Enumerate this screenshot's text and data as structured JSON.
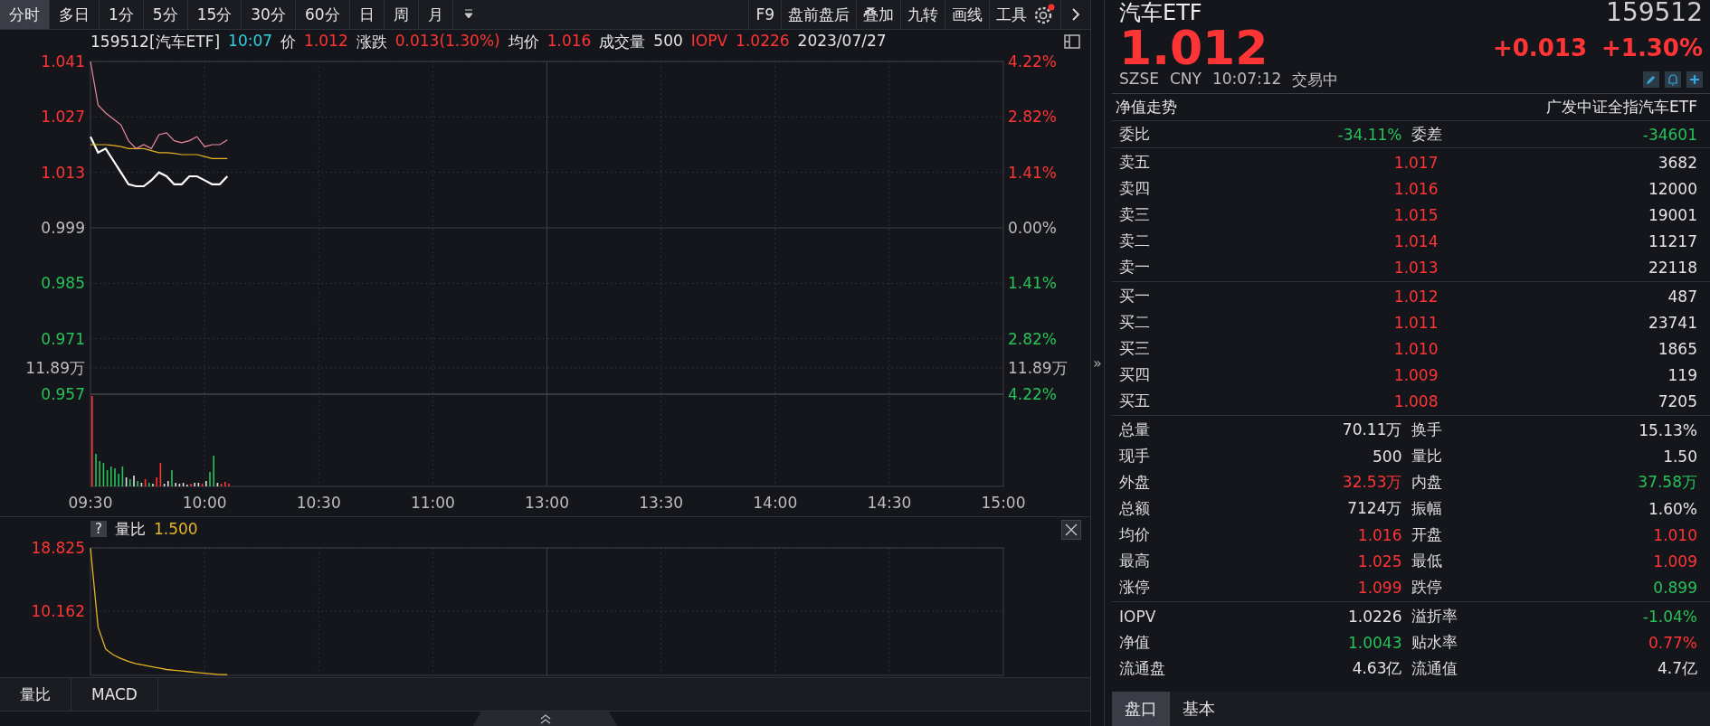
{
  "period_tabs": [
    {
      "label": "分时",
      "selected": true
    },
    {
      "label": "多日",
      "selected": false
    },
    {
      "label": "1分",
      "selected": false
    },
    {
      "label": "5分",
      "selected": false
    },
    {
      "label": "15分",
      "selected": false
    },
    {
      "label": "30分",
      "selected": false
    },
    {
      "label": "60分",
      "selected": false
    },
    {
      "label": "日",
      "selected": false
    },
    {
      "label": "周",
      "selected": false
    },
    {
      "label": "月",
      "selected": false
    }
  ],
  "tools": [
    "F9",
    "盘前盘后",
    "叠加",
    "九转",
    "画线",
    "工具"
  ],
  "chart_header": [
    {
      "text": "159512[汽车ETF]",
      "kind": "label"
    },
    {
      "text": "10:07",
      "kind": "time"
    },
    {
      "text": "价",
      "kind": "label"
    },
    {
      "text": "1.012",
      "kind": "up"
    },
    {
      "text": "涨跌",
      "kind": "label"
    },
    {
      "text": "0.013(1.30%)",
      "kind": "up"
    },
    {
      "text": "均价",
      "kind": "label"
    },
    {
      "text": "1.016",
      "kind": "up"
    },
    {
      "text": "成交量",
      "kind": "label"
    },
    {
      "text": "500",
      "kind": "label"
    },
    {
      "text": "IOPV",
      "kind": "up"
    },
    {
      "text": "1.0226",
      "kind": "up"
    },
    {
      "text": "2023/07/27",
      "kind": "label"
    }
  ],
  "price_chart": {
    "percent_labels": [
      "4.22%",
      "2.82%",
      "1.41%",
      "0.00%",
      "1.41%",
      "2.82%",
      "4.22%"
    ],
    "volume_labels": [
      "11.89万",
      "11.89万"
    ],
    "chart_data": {
      "type": "line",
      "categories": [
        "09:30",
        null,
        null,
        null,
        null,
        null,
        null,
        null,
        null,
        null,
        null,
        null,
        null,
        null,
        null,
        "10:00",
        null,
        null,
        null,
        null,
        null,
        null,
        null,
        null,
        null,
        null,
        null,
        null,
        null,
        null,
        "10:30",
        null,
        null,
        null,
        null,
        null,
        null,
        null,
        null,
        null,
        null,
        null,
        null,
        null,
        null,
        "11:00",
        null,
        null,
        null,
        null,
        null,
        null,
        null,
        null,
        null,
        null,
        null,
        null,
        null,
        null,
        "13:00",
        null,
        null,
        null,
        null,
        null,
        null,
        null,
        null,
        null,
        null,
        null,
        null,
        null,
        null,
        "13:30",
        null,
        null,
        null,
        null,
        null,
        null,
        null,
        null,
        null,
        null,
        null,
        null,
        null,
        null,
        "14:00",
        null,
        null,
        null,
        null,
        null,
        null,
        null,
        null,
        null,
        null,
        null,
        null,
        null,
        null,
        "14:30",
        null,
        null,
        null,
        null,
        null,
        null,
        null,
        null,
        null,
        null,
        null,
        null,
        null,
        null,
        "15:00"
      ],
      "series": [
        {
          "color": "#ffffff",
          "values": [
            1.022,
            1.018,
            1.019,
            1.016,
            1.013,
            1.01,
            1.0095,
            1.0095,
            1.011,
            1.013,
            1.012,
            1.01,
            1.01,
            1.012,
            1.012,
            1.011,
            1.01,
            1.01,
            1.012,
            null,
            null,
            null,
            null,
            null,
            null,
            null,
            null,
            null,
            null,
            null,
            null,
            null,
            null,
            null,
            null,
            null,
            null,
            null,
            null,
            null,
            null,
            null,
            null,
            null,
            null,
            null,
            null,
            null,
            null,
            null,
            null,
            null,
            null,
            null,
            null,
            null,
            null,
            null,
            null,
            null,
            null,
            null,
            null,
            null,
            null,
            null,
            null,
            null,
            null,
            null,
            null,
            null,
            null,
            null,
            null,
            null,
            null,
            null,
            null,
            null,
            null,
            null,
            null,
            null,
            null,
            null,
            null,
            null,
            null,
            null,
            null,
            null,
            null,
            null,
            null,
            null,
            null,
            null,
            null,
            null,
            null,
            null,
            null,
            null,
            null,
            null,
            null,
            null,
            null,
            null,
            null,
            null,
            null,
            null,
            null,
            null,
            null,
            null,
            null,
            null,
            null
          ]
        },
        {
          "color": "#e6b422",
          "values": [
            1.02,
            1.02,
            1.02,
            1.0198,
            1.0195,
            1.019,
            1.019,
            1.019,
            1.0185,
            1.018,
            1.018,
            1.0178,
            1.0175,
            1.0175,
            1.0175,
            1.017,
            1.0165,
            1.0165,
            1.0165,
            null,
            null,
            null,
            null,
            null,
            null,
            null,
            null,
            null,
            null,
            null,
            null,
            null,
            null,
            null,
            null,
            null,
            null,
            null,
            null,
            null,
            null,
            null,
            null,
            null,
            null,
            null,
            null,
            null,
            null,
            null,
            null,
            null,
            null,
            null,
            null,
            null,
            null,
            null,
            null,
            null,
            null,
            null,
            null,
            null,
            null,
            null,
            null,
            null,
            null,
            null,
            null,
            null,
            null,
            null,
            null,
            null,
            null,
            null,
            null,
            null,
            null,
            null,
            null,
            null,
            null,
            null,
            null,
            null,
            null,
            null,
            null,
            null,
            null,
            null,
            null,
            null,
            null,
            null,
            null,
            null,
            null,
            null,
            null,
            null,
            null,
            null,
            null,
            null,
            null,
            null,
            null,
            null,
            null,
            null,
            null,
            null,
            null,
            null,
            null,
            null,
            null
          ]
        },
        {
          "color": "#e88a9a",
          "values": [
            1.041,
            1.03,
            1.028,
            1.0265,
            1.025,
            1.021,
            1.019,
            1.02,
            1.019,
            1.0225,
            1.023,
            1.021,
            1.0205,
            1.021,
            1.022,
            1.0195,
            1.02,
            1.02,
            1.0212,
            null,
            null,
            null,
            null,
            null,
            null,
            null,
            null,
            null,
            null,
            null,
            null,
            null,
            null,
            null,
            null,
            null,
            null,
            null,
            null,
            null,
            null,
            null,
            null,
            null,
            null,
            null,
            null,
            null,
            null,
            null,
            null,
            null,
            null,
            null,
            null,
            null,
            null,
            null,
            null,
            null,
            null,
            null,
            null,
            null,
            null,
            null,
            null,
            null,
            null,
            null,
            null,
            null,
            null,
            null,
            null,
            null,
            null,
            null,
            null,
            null,
            null,
            null,
            null,
            null,
            null,
            null,
            null,
            null,
            null,
            null,
            null,
            null,
            null,
            null,
            null,
            null,
            null,
            null,
            null,
            null,
            null,
            null,
            null,
            null,
            null,
            null,
            null,
            null,
            null,
            null,
            null,
            null,
            null,
            null,
            null,
            null,
            null,
            null,
            null,
            null,
            null
          ]
        }
      ],
      "ylim": [
        0.957,
        1.041
      ],
      "grid": true,
      "yticks": [
        {
          "value": 1.041,
          "label": "1.041"
        },
        {
          "value": 1.027,
          "label": "1.027"
        },
        {
          "value": 1.013,
          "label": "1.013"
        },
        {
          "value": 0.999,
          "label": "0.999"
        },
        {
          "value": 0.985,
          "label": "0.985"
        },
        {
          "value": 0.971,
          "label": "0.971"
        },
        {
          "value": 0.957,
          "label": "0.957"
        }
      ]
    }
  },
  "indicator_pane": {
    "help": "?",
    "name": "量比",
    "value": "1.500",
    "chart_data": {
      "type": "line",
      "categories": [
        null,
        null,
        null,
        null,
        null,
        null,
        null,
        null,
        null,
        null,
        null,
        null,
        null,
        null,
        null,
        null,
        null,
        null,
        null,
        null,
        null,
        null,
        null,
        null,
        null,
        null,
        null,
        null,
        null,
        null,
        null,
        null,
        null,
        null,
        null,
        null,
        null,
        null,
        null,
        null,
        null,
        null,
        null,
        null,
        null,
        null,
        null,
        null,
        null,
        null,
        null,
        null,
        null,
        null,
        null,
        null,
        null,
        null,
        null,
        null,
        null,
        null,
        null,
        null,
        null,
        null,
        null,
        null,
        null,
        null,
        null,
        null,
        null,
        null,
        null,
        null,
        null,
        null,
        null,
        null,
        null,
        null,
        null,
        null,
        null,
        null,
        null,
        null,
        null,
        null,
        null,
        null,
        null,
        null,
        null,
        null,
        null,
        null,
        null,
        null,
        null,
        null,
        null,
        null,
        null,
        null,
        null,
        null,
        null,
        null,
        null,
        null,
        null,
        null,
        null,
        null,
        null,
        null,
        null,
        null,
        null
      ],
      "series": [
        {
          "color": "#e6b422",
          "values": [
            18.8,
            8.0,
            5.0,
            4.2,
            3.7,
            3.3,
            3.0,
            2.8,
            2.6,
            2.4,
            2.2,
            2.1,
            2.0,
            1.9,
            1.8,
            1.7,
            1.6,
            1.5,
            1.5,
            null,
            null,
            null,
            null,
            null,
            null,
            null,
            null,
            null,
            null,
            null,
            null,
            null,
            null,
            null,
            null,
            null,
            null,
            null,
            null,
            null,
            null,
            null,
            null,
            null,
            null,
            null,
            null,
            null,
            null,
            null,
            null,
            null,
            null,
            null,
            null,
            null,
            null,
            null,
            null,
            null,
            null,
            null,
            null,
            null,
            null,
            null,
            null,
            null,
            null,
            null,
            null,
            null,
            null,
            null,
            null,
            null,
            null,
            null,
            null,
            null,
            null,
            null,
            null,
            null,
            null,
            null,
            null,
            null,
            null,
            null,
            null,
            null,
            null,
            null,
            null,
            null,
            null,
            null,
            null,
            null,
            null,
            null,
            null,
            null,
            null,
            null,
            null,
            null,
            null,
            null,
            null,
            null,
            null,
            null,
            null,
            null,
            null,
            null,
            null,
            null,
            null
          ]
        }
      ],
      "ylim": [
        1.4,
        18.825
      ],
      "grid": true,
      "yticks": [
        {
          "value": 18.825,
          "label": "18.825"
        },
        {
          "value": 10.162,
          "label": "10.162"
        }
      ]
    }
  },
  "indicator_tabs": [
    "量比",
    "MACD"
  ],
  "collapse_handle": "»",
  "quote": {
    "name": "汽车ETF",
    "code": "159512",
    "price": "1.012",
    "change": "+0.013",
    "change_pct": "+1.30%",
    "exchange": "SZSE",
    "currency": "CNY",
    "time": "10:07:12",
    "status": "交易中"
  },
  "nav_section": {
    "title": "净值走势",
    "fund_name": "广发中证全指汽车ETF"
  },
  "order_ratio": [
    {
      "label": "委比",
      "value": "-34.11%",
      "color": "#27c25a"
    },
    {
      "label": "委差",
      "value": "-34601",
      "color": "#27c25a"
    }
  ],
  "asks": [
    {
      "label": "卖五",
      "price": "1.017",
      "volume": "3682",
      "color": "#ff3535"
    },
    {
      "label": "卖四",
      "price": "1.016",
      "volume": "12000",
      "color": "#ff3535"
    },
    {
      "label": "卖三",
      "price": "1.015",
      "volume": "19001",
      "color": "#ff3535"
    },
    {
      "label": "卖二",
      "price": "1.014",
      "volume": "11217",
      "color": "#ff3535"
    },
    {
      "label": "卖一",
      "price": "1.013",
      "volume": "22118",
      "color": "#ff3535"
    }
  ],
  "bids": [
    {
      "label": "买一",
      "price": "1.012",
      "volume": "487",
      "color": "#ff3535"
    },
    {
      "label": "买二",
      "price": "1.011",
      "volume": "23741",
      "color": "#ff3535"
    },
    {
      "label": "买三",
      "price": "1.010",
      "volume": "1865",
      "color": "#ff3535"
    },
    {
      "label": "买四",
      "price": "1.009",
      "volume": "119",
      "color": "#ff3535"
    },
    {
      "label": "买五",
      "price": "1.008",
      "volume": "7205",
      "color": "#ff3535"
    }
  ],
  "stats": [
    [
      {
        "label": "总量",
        "value": "70.11万",
        "color": "#e4e4e4"
      },
      {
        "label": "换手",
        "value": "15.13%",
        "color": "#e4e4e4"
      }
    ],
    [
      {
        "label": "现手",
        "value": "500",
        "color": "#e4e4e4"
      },
      {
        "label": "量比",
        "value": "1.50",
        "color": "#e4e4e4"
      }
    ],
    [
      {
        "label": "外盘",
        "value": "32.53万",
        "color": "#ff3535"
      },
      {
        "label": "内盘",
        "value": "37.58万",
        "color": "#27c25a"
      }
    ],
    [
      {
        "label": "总额",
        "value": "7124万",
        "color": "#e4e4e4"
      },
      {
        "label": "振幅",
        "value": "1.60%",
        "color": "#e4e4e4"
      }
    ],
    [
      {
        "label": "均价",
        "value": "1.016",
        "color": "#ff3535"
      },
      {
        "label": "开盘",
        "value": "1.010",
        "color": "#ff3535"
      }
    ],
    [
      {
        "label": "最高",
        "value": "1.025",
        "color": "#ff3535"
      },
      {
        "label": "最低",
        "value": "1.009",
        "color": "#ff3535"
      }
    ],
    [
      {
        "label": "涨停",
        "value": "1.099",
        "color": "#ff3535"
      },
      {
        "label": "跌停",
        "value": "0.899",
        "color": "#27c25a"
      }
    ]
  ],
  "fund_stats": [
    [
      {
        "label": "IOPV",
        "value": "1.0226",
        "color": "#e4e4e4"
      },
      {
        "label": "溢折率",
        "value": "-1.04%",
        "color": "#27c25a"
      }
    ],
    [
      {
        "label": "净值",
        "value": "1.0043",
        "color": "#27c25a"
      },
      {
        "label": "贴水率",
        "value": "0.77%",
        "color": "#ff3535"
      }
    ],
    [
      {
        "label": "流通盘",
        "value": "4.63亿",
        "color": "#e4e4e4"
      },
      {
        "label": "流通值",
        "value": "4.7亿",
        "color": "#e4e4e4"
      }
    ]
  ],
  "panel_tabs": [
    {
      "label": "盘口",
      "selected": true
    },
    {
      "label": "基本",
      "selected": false
    }
  ]
}
